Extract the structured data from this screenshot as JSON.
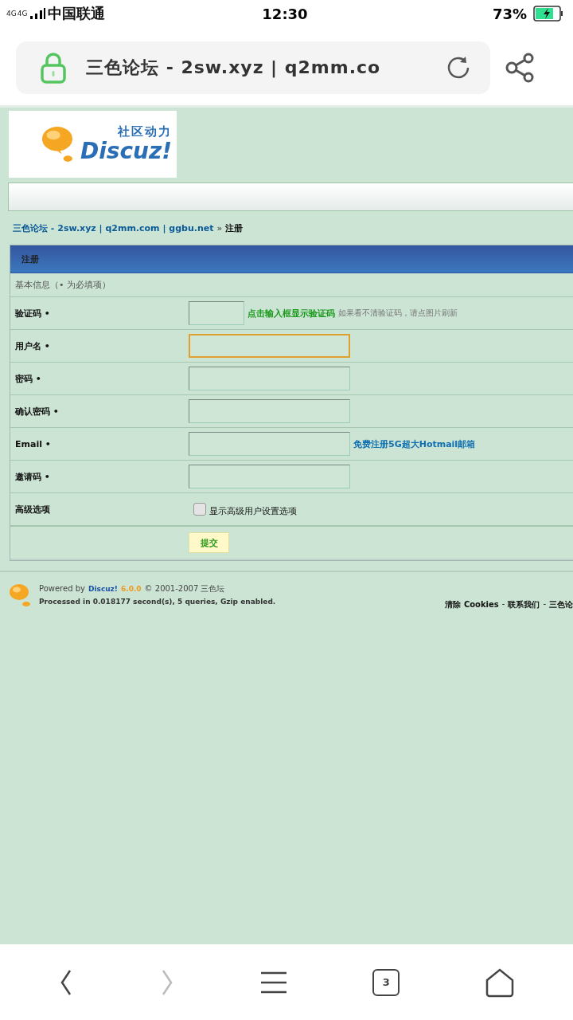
{
  "status_bar": {
    "network": [
      "4G",
      "4G"
    ],
    "carrier": "中国联通",
    "time": "12:30",
    "battery": "73%",
    "charging": true
  },
  "address_bar": {
    "title": "三色论坛 - 2sw.xyz | q2mm.co"
  },
  "logo": {
    "tagline": "社区动力",
    "brand": "Discuz!"
  },
  "breadcrumb": {
    "link": "三色论坛 - 2sw.xyz | q2mm.com | ggbu.net",
    "separator": "»",
    "current": "注册"
  },
  "form": {
    "title": "注册",
    "section": "基本信息（• 为必填项）",
    "rows": [
      {
        "kind": "captcha",
        "label": "验证码 •",
        "focused": false,
        "link": "点击输入框显示验证码",
        "hint": "如果看不清验证码，请点图片刷新"
      },
      {
        "kind": "text",
        "label": "用户名 •",
        "focused": true
      },
      {
        "kind": "text",
        "label": "密码 •",
        "focused": false
      },
      {
        "kind": "text",
        "label": "确认密码 •",
        "focused": false
      },
      {
        "kind": "text",
        "label": "Email •",
        "focused": false,
        "link": "免费注册5G超大Hotmail邮箱"
      },
      {
        "kind": "text",
        "label": "邀请码 •",
        "focused": false
      },
      {
        "kind": "checkbox",
        "label": "高级选项",
        "checked": false,
        "option": "显示高级用户设置选项"
      },
      {
        "kind": "submit",
        "button": "提交"
      }
    ]
  },
  "footer": {
    "powered": "Powered by",
    "brand": "Discuz!",
    "version": "6.0.0",
    "copyright": "© 2001-2007 三色坛",
    "processed": "Processed in 0.018177 second(s), 5 queries, Gzip enabled.",
    "links": [
      "清除 Cookies",
      "联系我们",
      "三色论"
    ],
    "separator": "-"
  },
  "bottom_nav": {
    "tab_count": "3"
  }
}
